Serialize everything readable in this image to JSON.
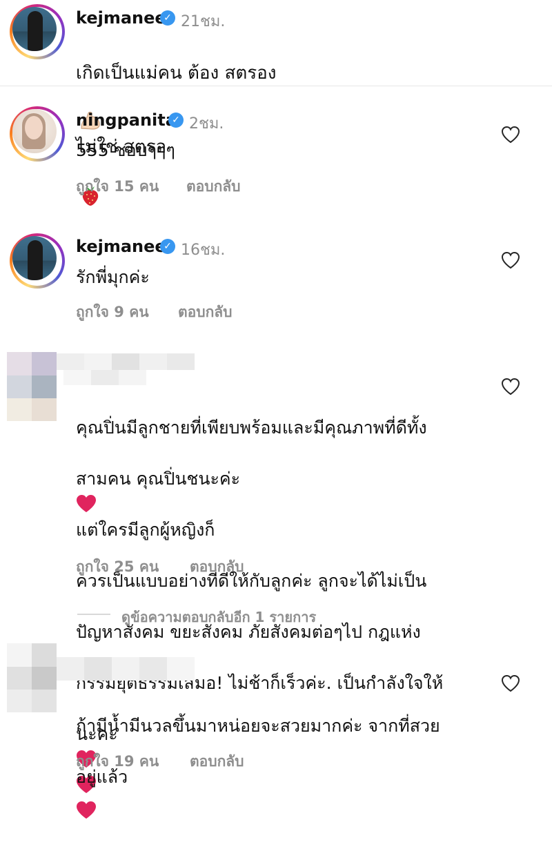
{
  "caption": {
    "username": "kejmanee",
    "time": "21ชม.",
    "text_part1": "เกิดเป็นแม่คน ต้อง สตรอง",
    "emoji1": "💪",
    "text_part2": "ไม่ใช่ สตรอ",
    "emoji2": "🍓"
  },
  "comments": [
    {
      "username": "ningpanita",
      "time": "2ชม.",
      "text": "555 ชอบๆๆๆ",
      "likes": "ถูกใจ 15 คน",
      "reply": "ตอบกลับ"
    },
    {
      "username": "kejmanee",
      "time": "16ชม.",
      "text": "รักพี่มุกค่ะ",
      "likes": "ถูกใจ 9 คน",
      "reply": "ตอบกลับ"
    },
    {
      "line1": "คุณปิ่นมีลูกชายที่เพียบพร้อมและมีคุณภาพที่ดีทั้ง",
      "line2a": "สามคน คุณปิ่นชนะค่ะ",
      "line2b": "แต่ใครมีลูกผู้หญิงก็",
      "line3": "ควรเป็นแบบอย่างที่ดีให้กับลูกค่ะ ลูกจะได้ไม่เป็น",
      "line4": "ปัญหาสังคม ขยะสังคม ภัยสังคมต่อๆไป กฎแห่ง",
      "line5": "กรรมยุติธรรมเสมอ! ไม่ช้าก็เร็วค่ะ. เป็นกำลังใจให้",
      "line6": "นะคะ",
      "likes": "ถูกใจ 25 คน",
      "reply": "ตอบกลับ"
    },
    {
      "line1": "ถ้ามีน้ำมีนวลขึ้นมาหน่อยจะสวยมากค่ะ จากที่สวย",
      "line2": "อยู่แล้ว",
      "likes": "ถูกใจ 19 คน",
      "reply": "ตอบกลับ"
    }
  ],
  "view_replies": "ดูข้อความตอบกลับอีก 1 รายการ",
  "colors": {
    "verified": "#3897f0",
    "secondary_text": "#8e8e8e",
    "heart_emoji": "#e0245e"
  }
}
